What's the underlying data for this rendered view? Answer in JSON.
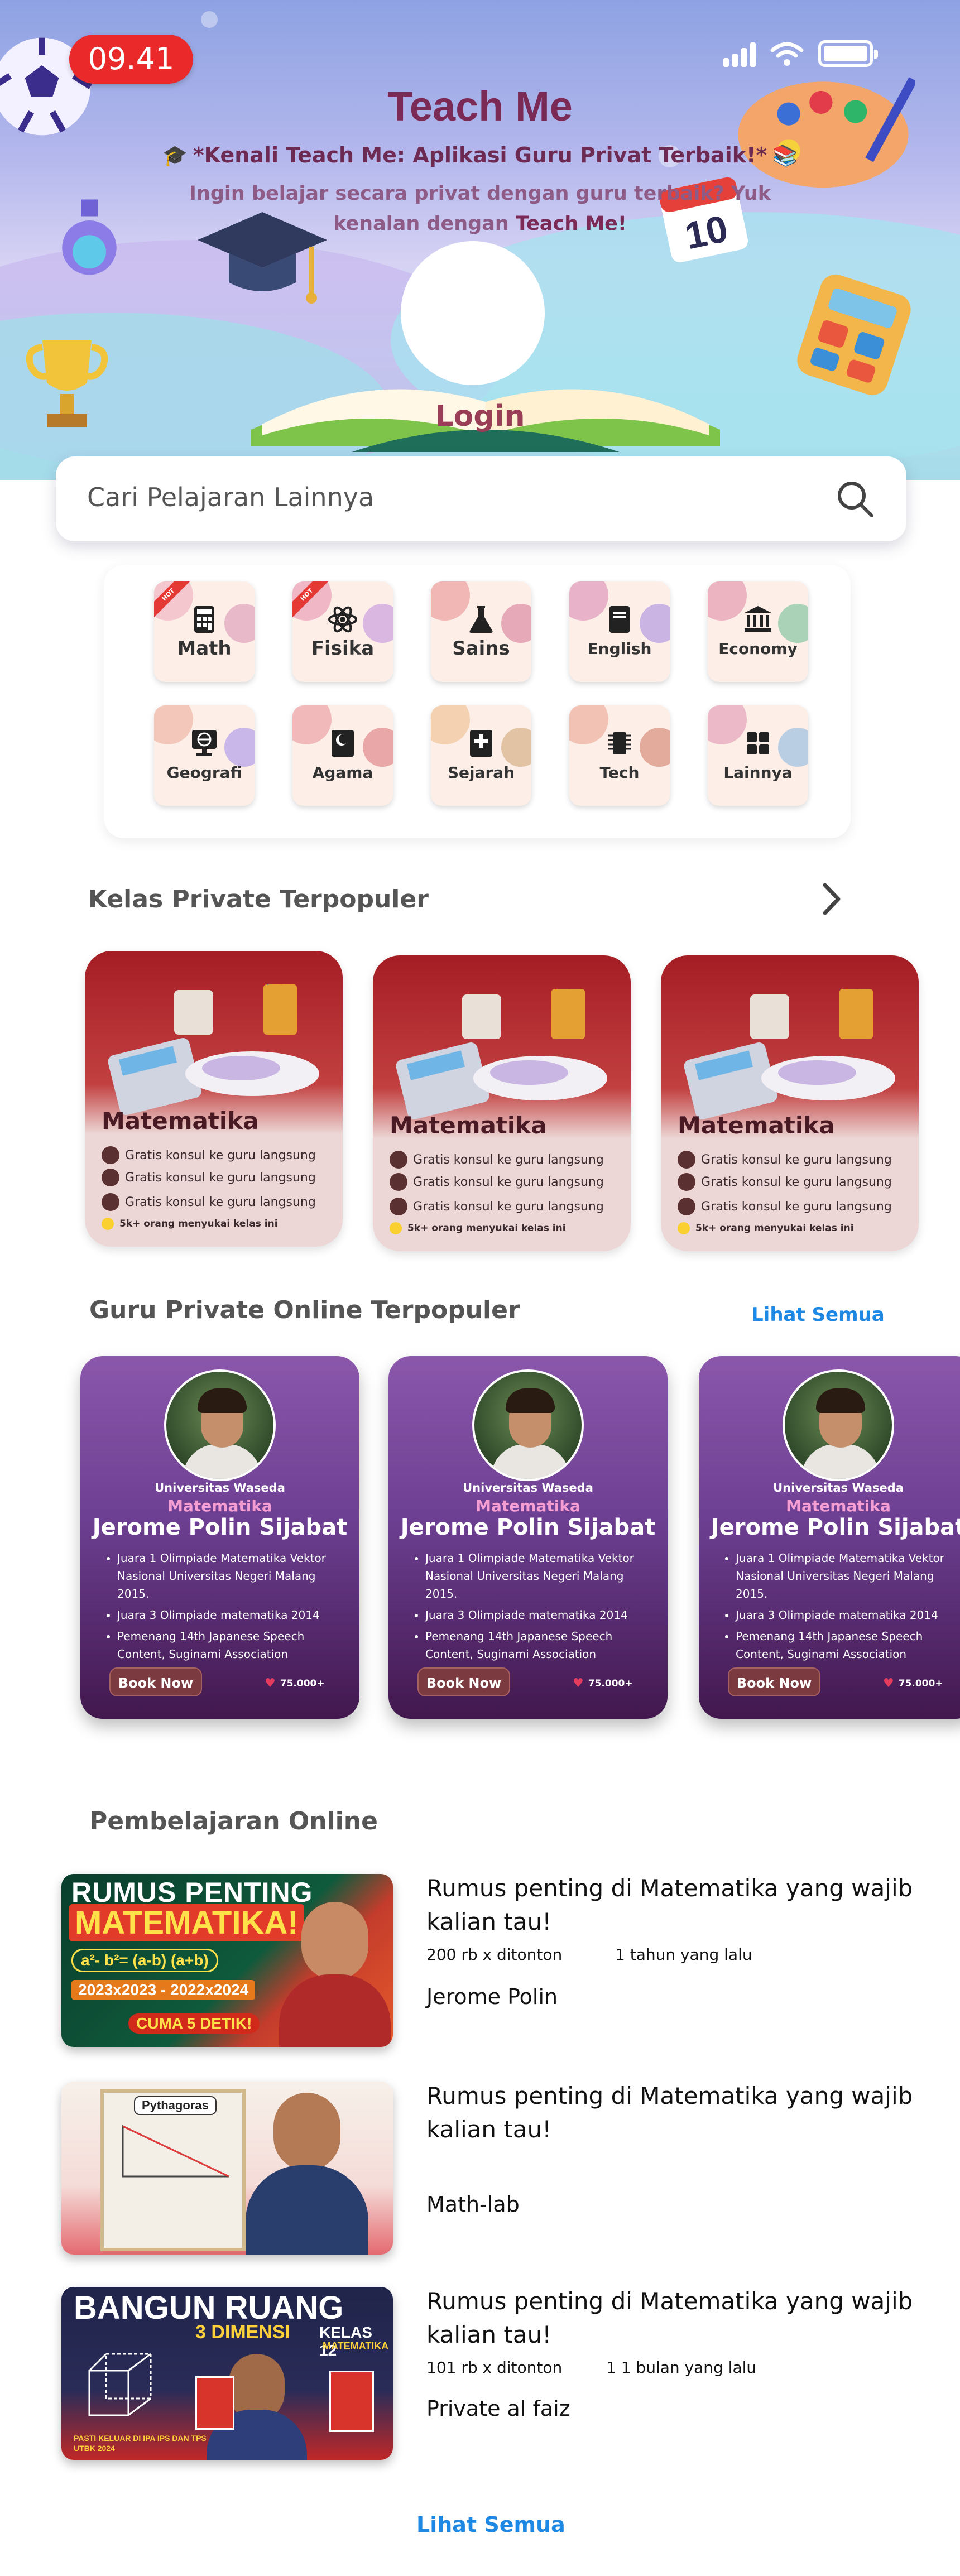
{
  "status_bar": {
    "time": "09.41"
  },
  "hero": {
    "title": "Teach Me",
    "tagline": "*Kenali Teach Me: Aplikasi Guru Privat Terbaik!*",
    "subtitle_1": "Ingin belajar secara privat dengan guru terbaik? Yuk",
    "subtitle_2": "kenalan dengan ",
    "subtitle_bold": "Teach Me!",
    "login_label": "Login"
  },
  "search": {
    "placeholder": "Cari Pelajaran Lainnya"
  },
  "categories": {
    "hot_badge": "HOT",
    "items": [
      {
        "label": "Math",
        "icon": "calculator-icon",
        "hot": true,
        "color": "#c97aa0"
      },
      {
        "label": "Fisika",
        "icon": "atom-icon",
        "hot": true,
        "color": "#b06a8a"
      },
      {
        "label": "Sains",
        "icon": "flask-icon",
        "hot": false,
        "color": "#d08a98"
      },
      {
        "label": "English",
        "icon": "book-icon",
        "hot": false,
        "color": "#9a7ac0"
      },
      {
        "label": "Economy",
        "icon": "bank-icon",
        "hot": false,
        "color": "#7aa58a"
      },
      {
        "label": "Geografi",
        "icon": "globe-icon",
        "hot": false,
        "color": "#8a7ac0"
      },
      {
        "label": "Agama",
        "icon": "mosque-icon",
        "hot": false,
        "color": "#d07a7a"
      },
      {
        "label": "Sejarah",
        "icon": "scroll-icon",
        "hot": false,
        "color": "#c0a07a"
      },
      {
        "label": "Tech",
        "icon": "chip-icon",
        "hot": false,
        "color": "#d0907a"
      },
      {
        "label": "Lainnya",
        "icon": "grid-icon",
        "hot": false,
        "color": "#8aa5c0"
      }
    ]
  },
  "popular_classes": {
    "title": "Kelas Private Terpopuler",
    "cards": [
      {
        "subject": "Matematika",
        "feature_1": "Gratis konsul ke guru langsung",
        "feature_2": "Gratis konsul ke guru langsung",
        "feature_3": "Gratis konsul ke guru langsung",
        "likes": "5k+ orang menyukai kelas ini"
      },
      {
        "subject": "Matematika",
        "feature_1": "Gratis konsul ke guru langsung",
        "feature_2": "Gratis konsul ke guru langsung",
        "feature_3": "Gratis konsul ke guru langsung",
        "likes": "5k+ orang menyukai kelas ini"
      },
      {
        "subject": "Matematika",
        "feature_1": "Gratis konsul ke guru langsung",
        "feature_2": "Gratis konsul ke guru langsung",
        "feature_3": "Gratis konsul ke guru langsung",
        "likes": "5k+ orang menyukai kelas ini"
      }
    ]
  },
  "popular_tutors": {
    "title": "Guru Private Online Terpopuler",
    "see_all": "Lihat Semua",
    "cards": [
      {
        "university": "Universitas Waseda",
        "subject": "Matematika",
        "name": "Jerome Polin Sijabat",
        "achievements": [
          "Juara 1 Olimpiade Matematika Vektor Nasional Universitas Negeri Malang 2015.",
          "Juara 3 Olimpiade matematika 2014",
          "Pemenang 14th Japanese Speech Content, Suginami Association"
        ],
        "book_label": "Book Now",
        "likes": "75.000+"
      },
      {
        "university": "Universitas Waseda",
        "subject": "Matematika",
        "name": "Jerome Polin Sijabat",
        "achievements": [
          "Juara 1 Olimpiade Matematika Vektor Nasional Universitas Negeri Malang 2015.",
          "Juara 3 Olimpiade matematika 2014",
          "Pemenang 14th Japanese Speech Content, Suginami Association"
        ],
        "book_label": "Book Now",
        "likes": "75.000+"
      },
      {
        "university": "Universitas Waseda",
        "subject": "Matematika",
        "name": "Jerome Polin Sijabat",
        "achievements": [
          "Juara 1 Olimpiade Matematika Vektor Nasional Universitas Negeri Malang 2015.",
          "Juara 3 Olimpiade matematika 2014",
          "Pemenang 14th Japanese Speech Content, Suginami Association"
        ],
        "book_label": "Book Now",
        "likes": "75.000+"
      }
    ]
  },
  "online_learning": {
    "title": "Pembelajaran Online",
    "see_all": "Lihat Semua",
    "videos": [
      {
        "title_1": "Rumus penting di Matematika yang wajib",
        "title_2": "kalian tau!",
        "views": "200 rb x ditonton",
        "age": "1 tahun yang lalu",
        "author": "Jerome Polin",
        "thumb_line1": "RUMUS PENTING",
        "thumb_line2": "MATEMATIKA!",
        "thumb_line3": "a²- b²= (a-b) (a+b)",
        "thumb_line4": "2023x2023 - 2022x2024",
        "thumb_line5": "CUMA 5 DETIK!"
      },
      {
        "title_1": "Rumus penting di Matematika yang wajib",
        "title_2": "kalian tau!",
        "views": "",
        "age": "",
        "author": "Math-lab",
        "thumb_line1": "Pythagoras"
      },
      {
        "title_1": "Rumus penting di Matematika yang wajib",
        "title_2": "kalian tau!",
        "views": "101 rb x ditonton",
        "age": "1 1 bulan yang lalu",
        "author": "Private al faiz",
        "thumb_line1": "BANGUN RUANG",
        "thumb_line2": "3 DIMENSI",
        "thumb_line3": "KELAS 12",
        "thumb_line4": "MATEMATIKA",
        "thumb_line5": "PASTI KELUAR DI IPA IPS DAN TPS UTBK 2024"
      }
    ]
  }
}
